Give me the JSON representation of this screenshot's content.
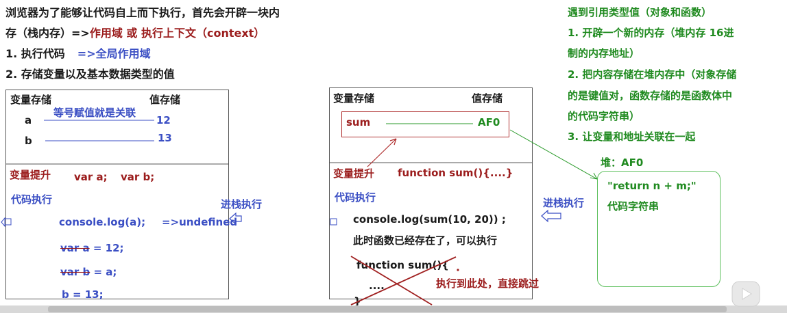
{
  "intro": {
    "line1": "浏览器为了能够让代码自上而下执行，首先会开辟一块内",
    "line2_a": "存（栈内存）=>",
    "line2_b": "作用域 或 执行上下文（context）",
    "line3_a": "1. 执行代码",
    "line3_b": "=>全局作用域",
    "line4": "2. 存储变量以及基本数据类型的值"
  },
  "right_notes": {
    "title": "遇到引用类型值（对象和函数）",
    "lines": [
      "1. 开辟一个新的内存（堆内存  16进",
      "制的内存地址）",
      "2. 把内容存储在堆内存中（对象存储",
      "的是键值对，函数存储的是函数体中",
      "的代码字符串）",
      "3. 让变量和地址关联在一起"
    ]
  },
  "left_panel": {
    "var_store": "变量存储",
    "val_store": "值存储",
    "assign_note": "等号赋值就是关联",
    "var_a": "a",
    "val_a": "12",
    "var_b": "b",
    "val_b": "13",
    "hoist_label": "变量提升",
    "hoist_code_a": "var a;",
    "hoist_code_b": "var b;",
    "exec_label": "代码执行",
    "stack_label": "进栈执行",
    "code_line1": "console.log(a);",
    "code_line1_result": "=>undefined",
    "code_line2_strike": "var a",
    "code_line2_rest": " = 12;",
    "code_line3_strike": "var b",
    "code_line3_rest": " = a;",
    "code_line4": "b = 13;"
  },
  "middle_panel": {
    "var_store": "变量存储",
    "val_store": "值存储",
    "var_sum": "sum",
    "val_sum": "AF0",
    "hoist_label": "变量提升",
    "hoist_code": "function sum(){....}",
    "exec_label": "代码执行",
    "stack_label": "进栈执行",
    "code_line1": "console.log(sum(10, 20)) ;",
    "code_line2": "此时函数已经存在了，可以执行",
    "code_line3": "function sum(){",
    "code_line4": "....",
    "skip_note": "执行到此处，直接跳过",
    "code_line5": "}"
  },
  "heap": {
    "label": "堆：AF0",
    "content_line1": "\"return n + m;\"",
    "content_line2": "代码字符串"
  },
  "colors": {
    "red": "#9b1c1c",
    "blue": "#3b4fc4",
    "green": "#1f8a1f"
  }
}
